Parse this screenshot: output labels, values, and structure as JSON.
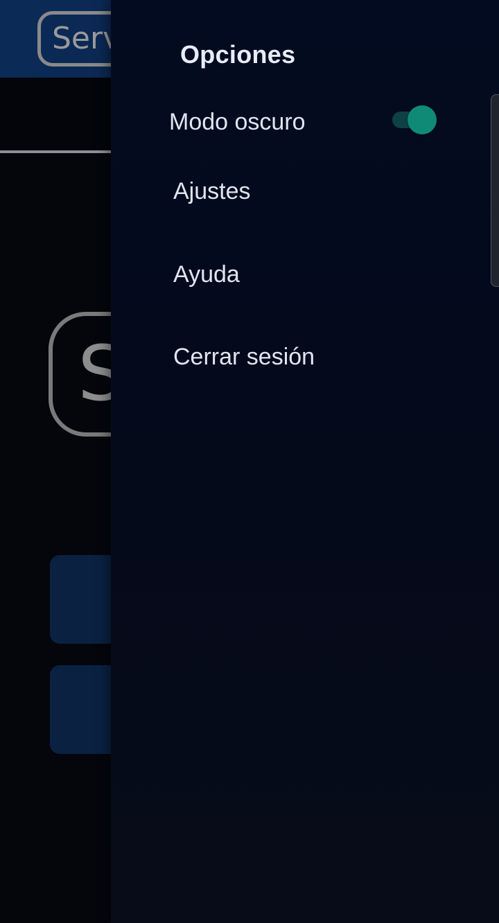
{
  "app": {
    "header_logo_text": "Serv",
    "big_logo_text": "S"
  },
  "drawer": {
    "title": "Opciones",
    "dark_mode": {
      "label": "Modo oscuro",
      "enabled": true,
      "track_color": "#0e4146",
      "thumb_color": "#0f8a77"
    },
    "items": [
      {
        "label": "Ajustes"
      },
      {
        "label": "Ayuda"
      },
      {
        "label": "Cerrar sesión"
      }
    ]
  },
  "colors": {
    "header_bg": "#0b2a57",
    "drawer_bg": "#030b20",
    "card_bg": "#0a2142",
    "text_primary": "#dfe6f0"
  }
}
